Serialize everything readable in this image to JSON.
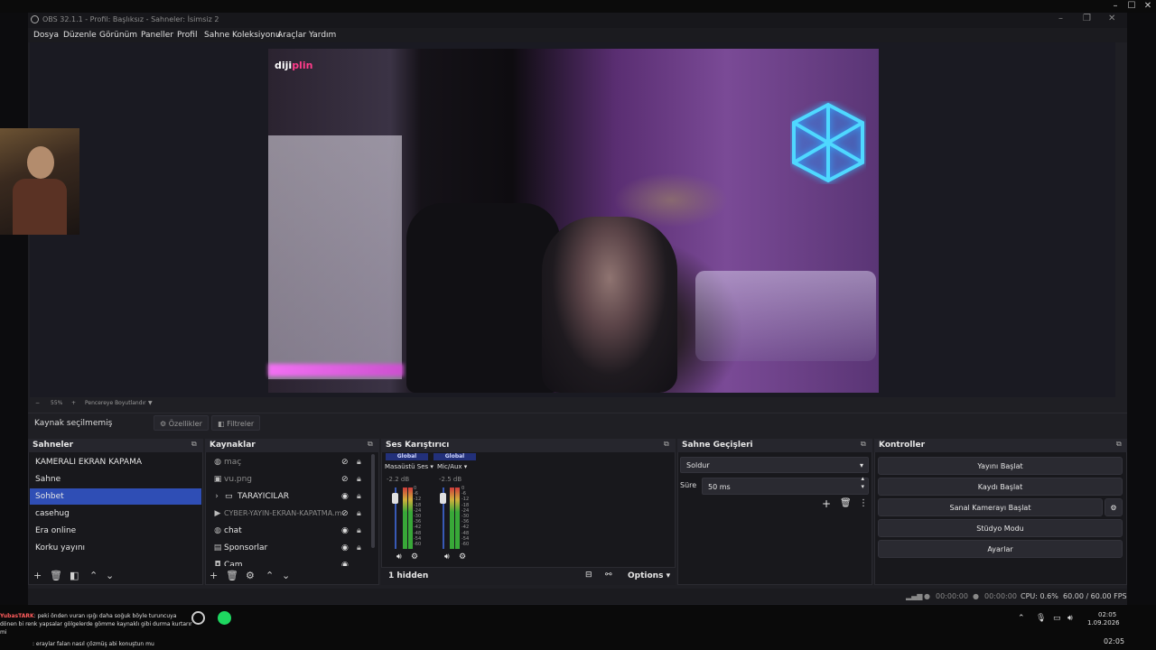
{
  "window": {
    "title": "OBS 32.1.1 - Profil: Başlıksız - Sahneler: İsimsiz 2"
  },
  "menu": [
    "Dosya",
    "Düzenle",
    "Görünüm",
    "Paneller",
    "Profil",
    "Sahne Koleksiyonu",
    "Araçlar",
    "Yardım"
  ],
  "preview": {
    "logo_a": "diji",
    "logo_b": "plin",
    "zoom": "55%",
    "zoom_mode": "Pencereye Boyutlandır"
  },
  "source_toolbar": {
    "none_selected": "Kaynak seçilmemiş",
    "properties": "Özellikler",
    "filters": "Filtreler"
  },
  "scenes": {
    "title": "Sahneler",
    "items": [
      "KAMERALI EKRAN KAPAMA",
      "Sahne",
      "Sohbet",
      "casehug",
      "Era online",
      "Korku yayını"
    ],
    "selected": "Sohbet"
  },
  "sources": {
    "title": "Kaynaklar",
    "items": [
      {
        "name": "maç",
        "icon": "globe-icon",
        "visible": false
      },
      {
        "name": "vu.png",
        "icon": "image-icon",
        "visible": false
      },
      {
        "name": "TARAYICILAR",
        "icon": "folder-icon",
        "visible": true
      },
      {
        "name": "CYBER-YAYIN-EKRAN-KAPATMA.m",
        "icon": "media-icon",
        "visible": false
      },
      {
        "name": "chat",
        "icon": "globe-icon",
        "visible": true
      },
      {
        "name": "Sponsorlar",
        "icon": "slideshow-icon",
        "visible": true
      },
      {
        "name": "Cam",
        "icon": "camera-icon",
        "visible": true
      }
    ]
  },
  "mixer": {
    "title": "Ses Karıştırıcı",
    "channels": [
      {
        "tag": "Global",
        "name": "Masaüstü Ses",
        "db": "-2.2 dB"
      },
      {
        "tag": "Global",
        "name": "Mic/Aux",
        "db": "-2.5 dB"
      }
    ],
    "scale": [
      "0",
      "-6",
      "-12",
      "-18",
      "-24",
      "-30",
      "-36",
      "-42",
      "-48",
      "-54",
      "-60"
    ],
    "hidden": "1 hidden",
    "options": "Options"
  },
  "transitions": {
    "title": "Sahne Geçişleri",
    "selected": "Soldur",
    "duration_label": "Süre",
    "duration": "50 ms"
  },
  "controls": {
    "title": "Kontroller",
    "buttons": [
      "Yayını Başlat",
      "Kaydı Başlat",
      "Sanal Kamerayı Başlat",
      "Stüdyo Modu",
      "Ayarlar"
    ]
  },
  "status": {
    "stream_time": "00:00:00",
    "record_time": "00:00:00",
    "cpu": "CPU: 0.6%",
    "fps": "60.00 / 60.00 FPS"
  },
  "taskbar": {
    "chat_line1_user": "YubasTARK",
    "chat_line1": ": peki önden vuran ışığı daha soğuk böyle turuncuya",
    "chat_line2": "dönen bi renk yapsalar gölgelerde gömme kaynaklı gibi durma kurtarır",
    "chat_line3_prefix": "mi",
    "chat_line4": ": eraylar falan nasıl çözmüş abi konuştun mu",
    "time": "02:05",
    "date": "1.09.2026",
    "time2": "02:05"
  },
  "colors": {
    "selection": "#2f4eb5",
    "panel": "#18181c",
    "header": "#26262d",
    "meter_green": "#38a838"
  }
}
